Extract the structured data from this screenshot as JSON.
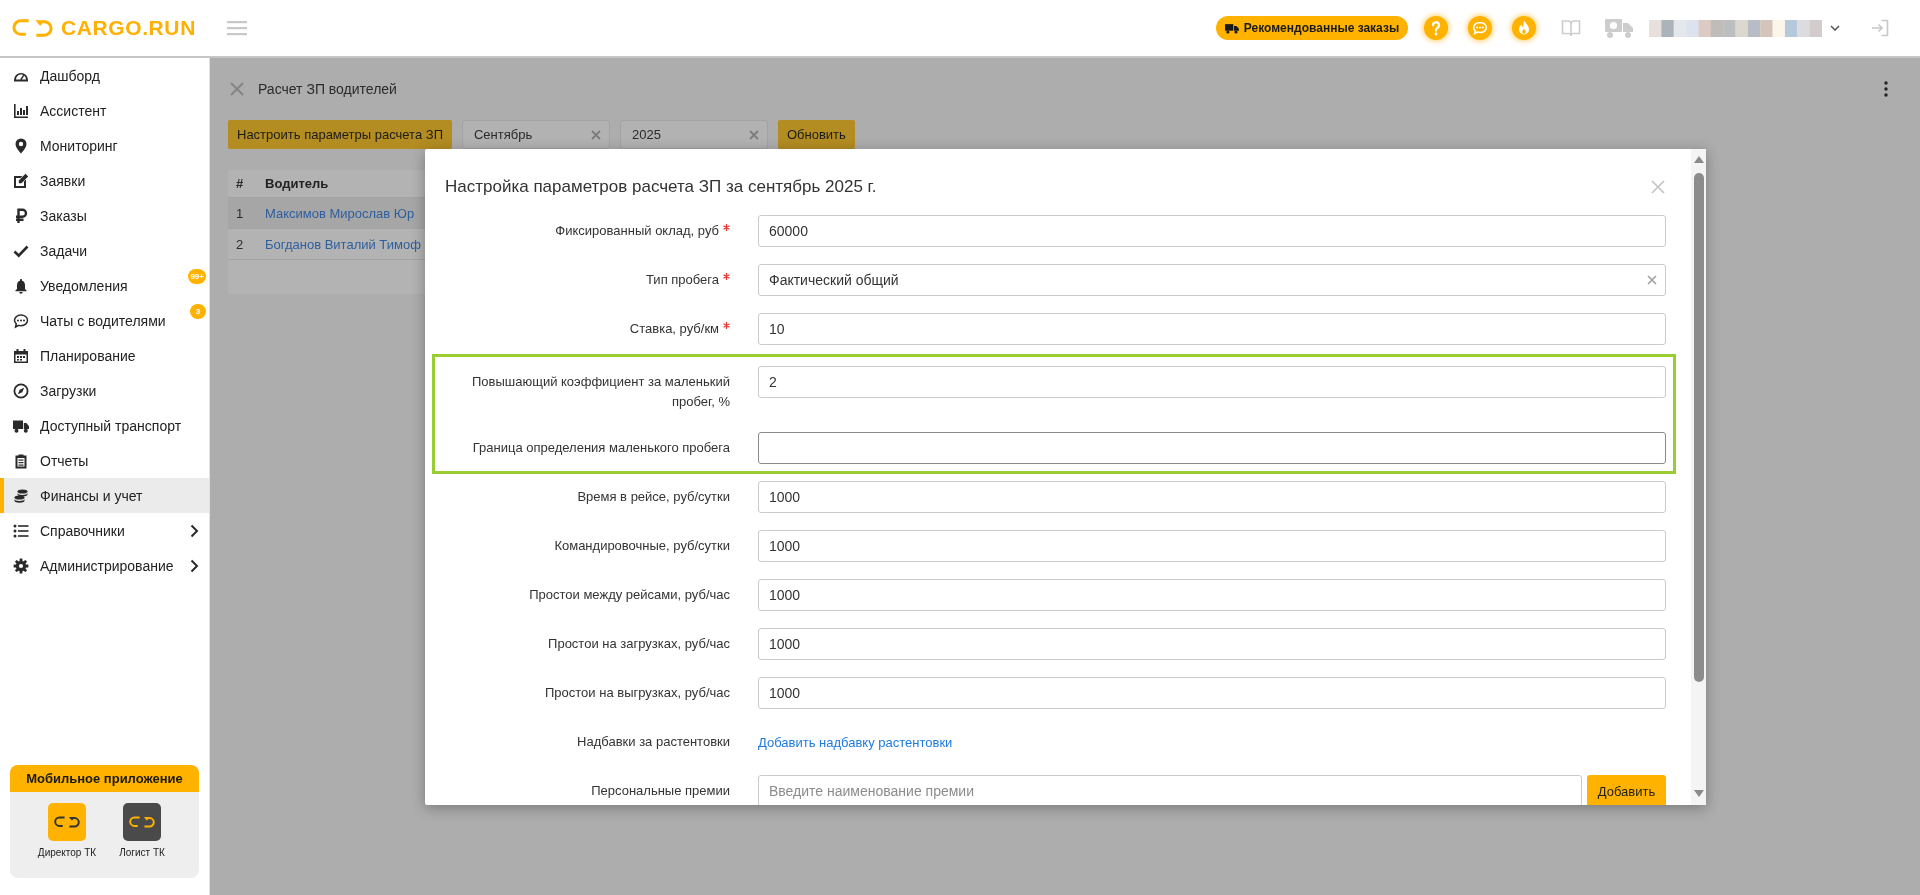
{
  "header": {
    "logo": "CARGO.RUN",
    "recommended_button": "Рекомендованные заказы"
  },
  "sidebar": {
    "items": [
      {
        "label": "Дашборд",
        "selected": false,
        "expandable": false
      },
      {
        "label": "Ассистент",
        "selected": false,
        "expandable": false
      },
      {
        "label": "Мониторинг",
        "selected": false,
        "expandable": false
      },
      {
        "label": "Заявки",
        "selected": false,
        "expandable": false
      },
      {
        "label": "Заказы",
        "selected": false,
        "expandable": false
      },
      {
        "label": "Задачи",
        "selected": false,
        "expandable": false
      },
      {
        "label": "Уведомления",
        "selected": false,
        "expandable": false,
        "badge": "99+"
      },
      {
        "label": "Чаты с водителями",
        "selected": false,
        "expandable": false,
        "badge": "3"
      },
      {
        "label": "Планирование",
        "selected": false,
        "expandable": false
      },
      {
        "label": "Загрузки",
        "selected": false,
        "expandable": false
      },
      {
        "label": "Доступный транспорт",
        "selected": false,
        "expandable": false
      },
      {
        "label": "Отчеты",
        "selected": false,
        "expandable": false
      },
      {
        "label": "Финансы и учет",
        "selected": true,
        "expandable": false
      },
      {
        "label": "Справочники",
        "selected": false,
        "expandable": true
      },
      {
        "label": "Администрирование",
        "selected": false,
        "expandable": true
      }
    ],
    "mobile_app": {
      "title": "Мобильное приложение",
      "apps": [
        {
          "label": "Директор ТК",
          "color": "#ffb300"
        },
        {
          "label": "Логист ТК",
          "color": "#4a4a4a"
        }
      ]
    }
  },
  "page": {
    "title": "Расчет ЗП водителей",
    "settings_button": "Настроить параметры расчета ЗП",
    "month_select": "Сентябрь",
    "year_select": "2025",
    "refresh_button": "Обновить",
    "table": {
      "columns": [
        "#",
        "Водитель"
      ],
      "rows": [
        [
          "1",
          "Максимов Мирослав Юр"
        ],
        [
          "2",
          "Богданов Виталий Тимоф"
        ]
      ]
    }
  },
  "modal": {
    "title": "Настройка параметров расчета ЗП за сентябрь 2025 г.",
    "fields": [
      {
        "kind": "input",
        "label": "Фиксированный оклад, руб",
        "required": true,
        "highlighted": false,
        "focused": false,
        "value": "60000"
      },
      {
        "kind": "select",
        "label": "Тип пробега",
        "required": true,
        "highlighted": false,
        "focused": false,
        "value": "Фактический общий"
      },
      {
        "kind": "input",
        "label": "Ставка, руб/км",
        "required": true,
        "highlighted": false,
        "focused": false,
        "value": "10"
      },
      {
        "kind": "input",
        "label": "Повышающий коэффициент за маленький пробег, %",
        "required": false,
        "highlighted": true,
        "focused": false,
        "value": "2"
      },
      {
        "kind": "input",
        "label": "Граница определения маленького пробега",
        "required": false,
        "highlighted": true,
        "focused": true
      },
      {
        "kind": "input",
        "label": "Время в рейсе, руб/сутки",
        "required": false,
        "highlighted": false,
        "focused": false,
        "value": "1000"
      },
      {
        "kind": "input",
        "label": "Командировочные, руб/сутки",
        "required": false,
        "highlighted": false,
        "focused": false,
        "value": "1000"
      },
      {
        "kind": "input",
        "label": "Простои между рейсами, руб/час",
        "required": false,
        "highlighted": false,
        "focused": false,
        "value": "1000"
      },
      {
        "kind": "input",
        "label": "Простои на загрузках, руб/час",
        "required": false,
        "highlighted": false,
        "focused": false,
        "value": "1000"
      },
      {
        "kind": "input",
        "label": "Простои на выгрузках, руб/час",
        "required": false,
        "highlighted": false,
        "focused": false,
        "value": "1000"
      },
      {
        "kind": "link",
        "label": "Надбавки за растентовки",
        "required": false,
        "highlighted": false,
        "focused": false,
        "link": "Добавить надбавку растентовки"
      },
      {
        "kind": "input_button",
        "label": "Персональные премии",
        "required": false,
        "highlighted": false,
        "focused": false,
        "placeholder": "Введите наименование премии",
        "button": "Добавить"
      }
    ]
  }
}
